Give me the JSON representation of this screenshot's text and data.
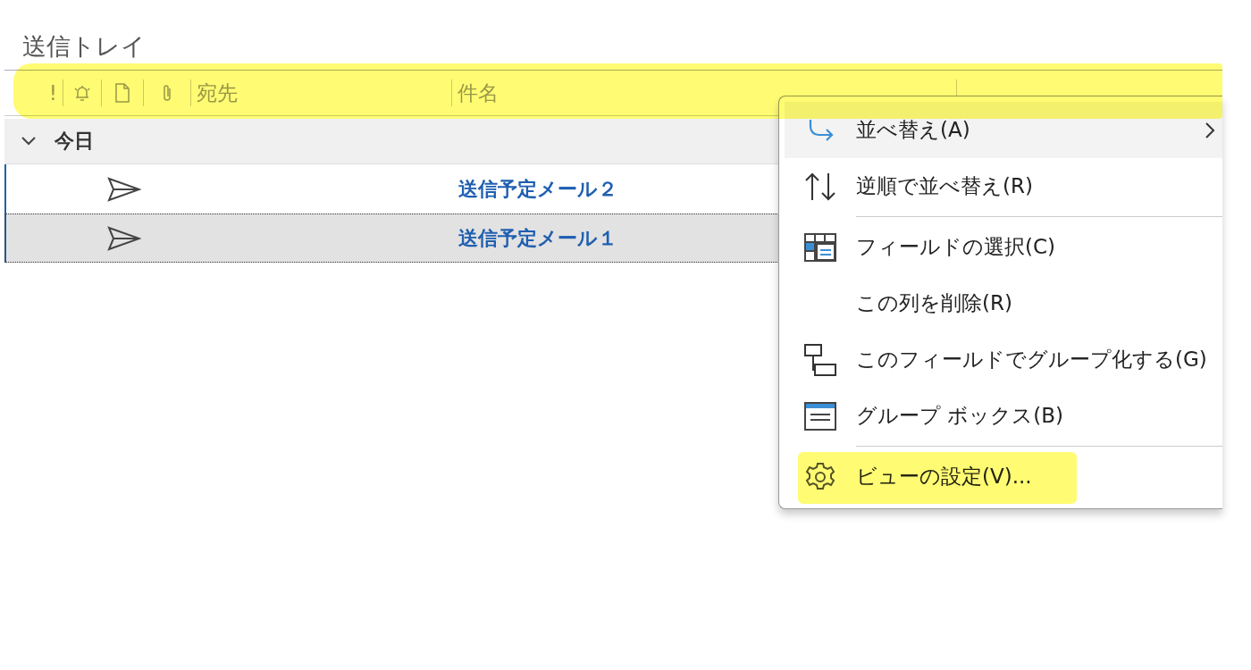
{
  "folder_title": "送信トレイ",
  "column_header": {
    "highlighted": true,
    "columns": [
      {
        "kind": "text",
        "label": "!"
      },
      {
        "kind": "bell"
      },
      {
        "kind": "document"
      },
      {
        "kind": "attachment"
      },
      {
        "kind": "text",
        "label": "宛先"
      },
      {
        "kind": "text",
        "label": "件名"
      }
    ]
  },
  "groups": [
    {
      "label": "今日",
      "expanded": true,
      "messages": [
        {
          "subject": "送信予定メール２",
          "selected": false
        },
        {
          "subject": "送信予定メール１",
          "selected": true
        }
      ]
    }
  ],
  "context_menu": {
    "items": [
      {
        "kind": "sort",
        "label": "並べ替え(A)",
        "submenu": true,
        "hovered": true,
        "highlighted": false,
        "separator_after": false
      },
      {
        "kind": "reverse",
        "label": "逆順で並べ替え(R)",
        "submenu": false,
        "hovered": false,
        "highlighted": false,
        "separator_after": true
      },
      {
        "kind": "fields",
        "label": "フィールドの選択(C)",
        "submenu": false,
        "hovered": false,
        "highlighted": false,
        "separator_after": false
      },
      {
        "kind": "plain",
        "label": "この列を削除(R)",
        "submenu": false,
        "hovered": false,
        "highlighted": false,
        "separator_after": false
      },
      {
        "kind": "group",
        "label": "このフィールドでグループ化する(G)",
        "submenu": false,
        "hovered": false,
        "highlighted": false,
        "separator_after": false
      },
      {
        "kind": "groupbox",
        "label": "グループ ボックス(B)",
        "submenu": false,
        "hovered": false,
        "highlighted": false,
        "separator_after": true
      },
      {
        "kind": "settings",
        "label": "ビューの設定(V)...",
        "submenu": false,
        "hovered": false,
        "highlighted": true,
        "separator_after": false
      }
    ]
  }
}
